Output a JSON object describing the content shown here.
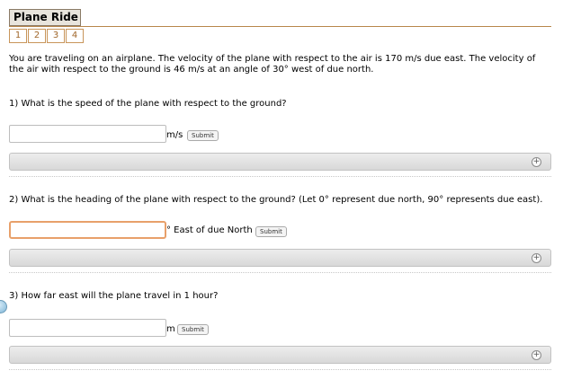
{
  "header": {
    "title": "Plane Ride",
    "pages": [
      "1",
      "2",
      "3",
      "4"
    ]
  },
  "intro": "You are traveling on an airplane. The velocity of the plane with respect to the air is 170 m/s due east. The velocity of the air with respect to the ground is 46 m/s at an angle of 30° west of due north.",
  "questions": [
    {
      "text": "1) What is the speed of the plane with respect to the ground?",
      "unit": "m/s",
      "submit": "Submit",
      "value": ""
    },
    {
      "text": "2) What is the heading of the plane with respect to the ground? (Let 0° represent due north, 90° represents due east).",
      "unit": "° East of due North",
      "submit": "Submit",
      "value": ""
    },
    {
      "text": "3) How far east will the plane travel in 1 hour?",
      "unit": "m",
      "submit": "Submit",
      "value": ""
    }
  ],
  "icons": {
    "hint_toggle": "plus-circle-icon"
  },
  "colors": {
    "accent": "#c8955a",
    "focus": "#e8a06a"
  }
}
